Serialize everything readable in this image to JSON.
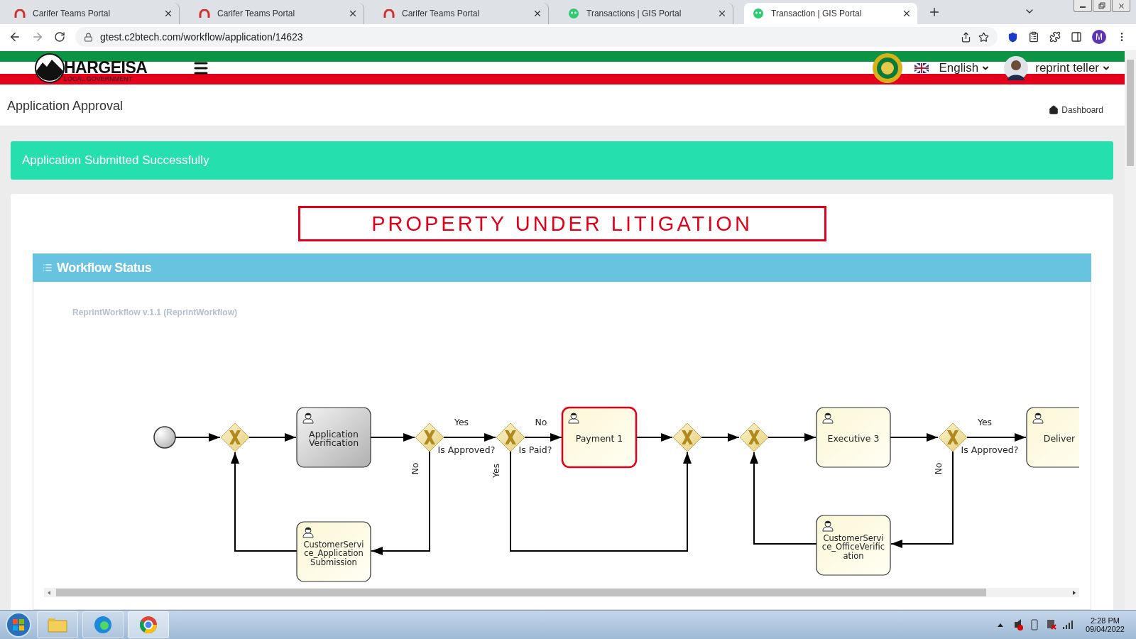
{
  "browser": {
    "tabs": [
      {
        "title": "Carifer Teams Portal",
        "kind": "carifer",
        "selected": false
      },
      {
        "title": "Carifer Teams Portal",
        "kind": "carifer",
        "selected": false
      },
      {
        "title": "Carifer Teams Portal",
        "kind": "carifer",
        "selected": false
      },
      {
        "title": "Transactions | GIS Portal",
        "kind": "gis",
        "selected": false
      },
      {
        "title": "Transaction | GIS Portal",
        "kind": "gis",
        "selected": true
      }
    ],
    "url": "gtest.c2btech.com/workflow/application/14623",
    "profile_initial": "M"
  },
  "header": {
    "logo_title": "HARGEISA",
    "logo_subtitle": "LOCAL GOVERNMENT",
    "language": "English",
    "user": "reprint teller"
  },
  "page": {
    "title": "Application Approval",
    "breadcrumb": "Dashboard"
  },
  "alert": "Application Submitted Successfully",
  "litigation_banner": "PROPERTY UNDER LITIGATION",
  "workflow": {
    "title": "Workflow Status",
    "process": "ReprintWorkflow v.1.1 (ReprintWorkflow)",
    "nodes": [
      {
        "kind": "start"
      },
      {
        "kind": "gateway"
      },
      {
        "kind": "task",
        "lines": [
          "Application",
          "Verification"
        ],
        "completed": true,
        "active": false
      },
      {
        "kind": "gateway"
      },
      {
        "kind": "gateway"
      },
      {
        "kind": "task",
        "lines": [
          "Payment 1"
        ],
        "completed": false,
        "active": true
      },
      {
        "kind": "gateway"
      },
      {
        "kind": "gateway"
      },
      {
        "kind": "task",
        "lines": [
          "Executive 3"
        ],
        "completed": false,
        "active": false
      },
      {
        "kind": "gateway"
      },
      {
        "kind": "task",
        "lines": [
          "Deliver"
        ],
        "completed": false,
        "active": false
      },
      {
        "kind": "task",
        "lines": [
          "CustomerServi",
          "ce_Application",
          "Submission"
        ],
        "completed": false,
        "active": false
      },
      {
        "kind": "task",
        "lines": [
          "CustomerServi",
          "ce_OfficeVerific",
          "ation"
        ],
        "completed": false,
        "active": false
      }
    ],
    "edge_labels": [
      "Yes",
      "No",
      "Yes",
      "Is Approved?",
      "Is Paid?",
      "Is Approved?",
      "No",
      "Yes",
      "No"
    ]
  },
  "taskbar": {
    "time": "2:28 PM",
    "date": "09/04/2022"
  }
}
